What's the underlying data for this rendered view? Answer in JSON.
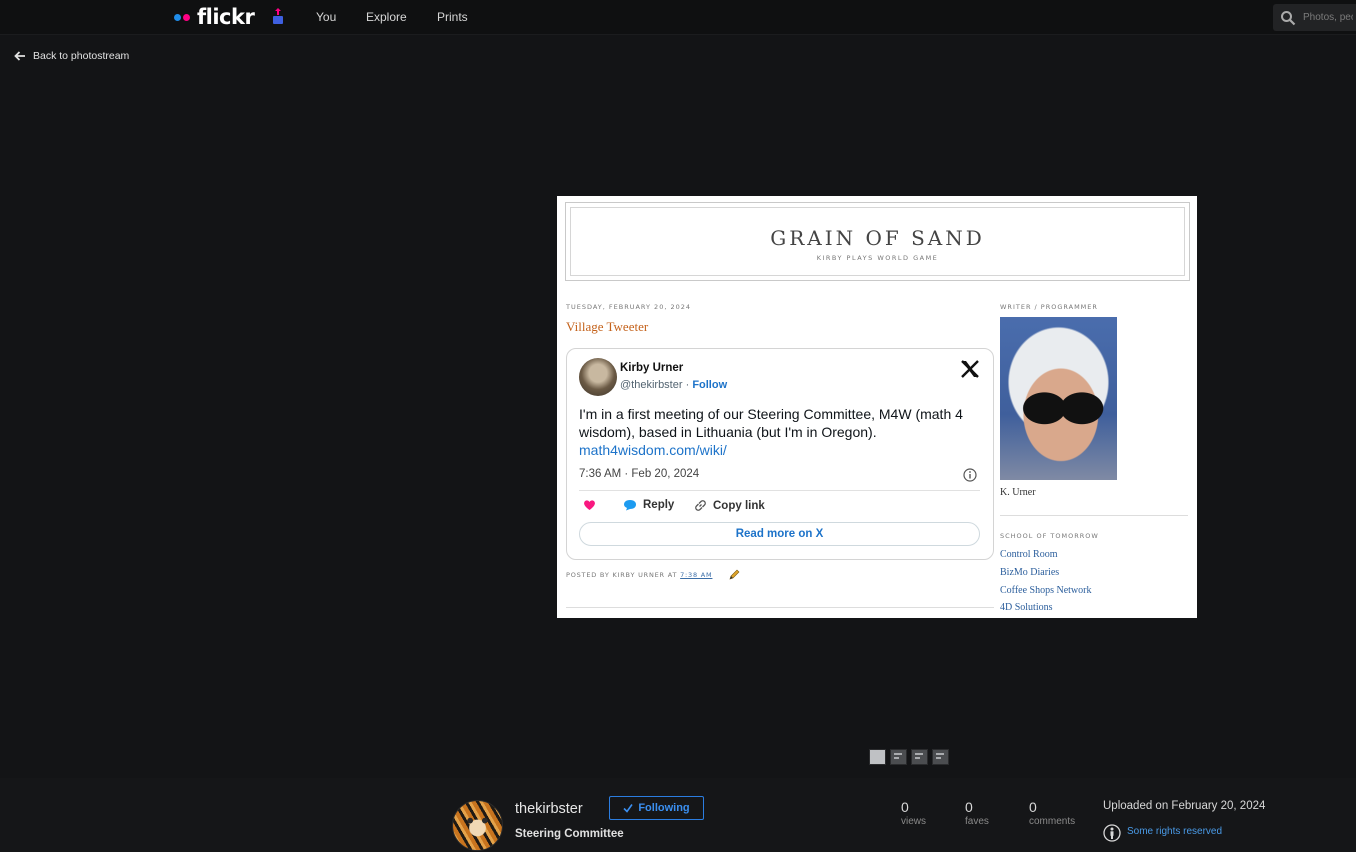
{
  "nav": {
    "logo": "flickr",
    "links": [
      "You",
      "Explore",
      "Prints"
    ],
    "search_placeholder": "Photos, people, or groups"
  },
  "back": {
    "label": "Back to photostream"
  },
  "photo": {
    "blog_title": "GRAIN OF SAND",
    "blog_subtitle": "KIRBY PLAYS WORLD GAME",
    "post_date": "TUESDAY, FEBRUARY 20, 2024",
    "post_title": "Village Tweeter",
    "tweet": {
      "name": "Kirby Urner",
      "handle": "@thekirbster",
      "follow": "Follow",
      "text": "I'm in a first meeting of our Steering Committee, M4W (math 4 wisdom), based in Lithuania (but I'm in Oregon).",
      "link": "math4wisdom.com/wiki/",
      "time": "7:36 AM · Feb 20, 2024",
      "reply": "Reply",
      "copy_link": "Copy link",
      "read_more": "Read more on X"
    },
    "posted_by": "POSTED BY KIRBY URNER AT",
    "posted_time": "7:38 AM",
    "sidebar": {
      "heading1": "WRITER / PROGRAMMER",
      "caption": "K. Urner",
      "heading2": "SCHOOL OF TOMORROW",
      "links": [
        "Control Room",
        "BizMo Diaries",
        "Coffee Shops Network",
        "4D Solutions"
      ]
    }
  },
  "owner": {
    "name": "thekirbster",
    "follow_label": "Following",
    "photo_title": "Steering Committee"
  },
  "stats": {
    "views": {
      "value": "0",
      "label": "views"
    },
    "faves": {
      "value": "0",
      "label": "faves"
    },
    "comments": {
      "value": "0",
      "label": "comments"
    }
  },
  "meta": {
    "uploaded": "Uploaded on February 20, 2024",
    "license": "Some rights reserved"
  },
  "colors": {
    "accent": "#2b7de0",
    "flickr_blue": "#1f8ce9",
    "flickr_pink": "#ff0084",
    "post_title": "#c4621b"
  }
}
